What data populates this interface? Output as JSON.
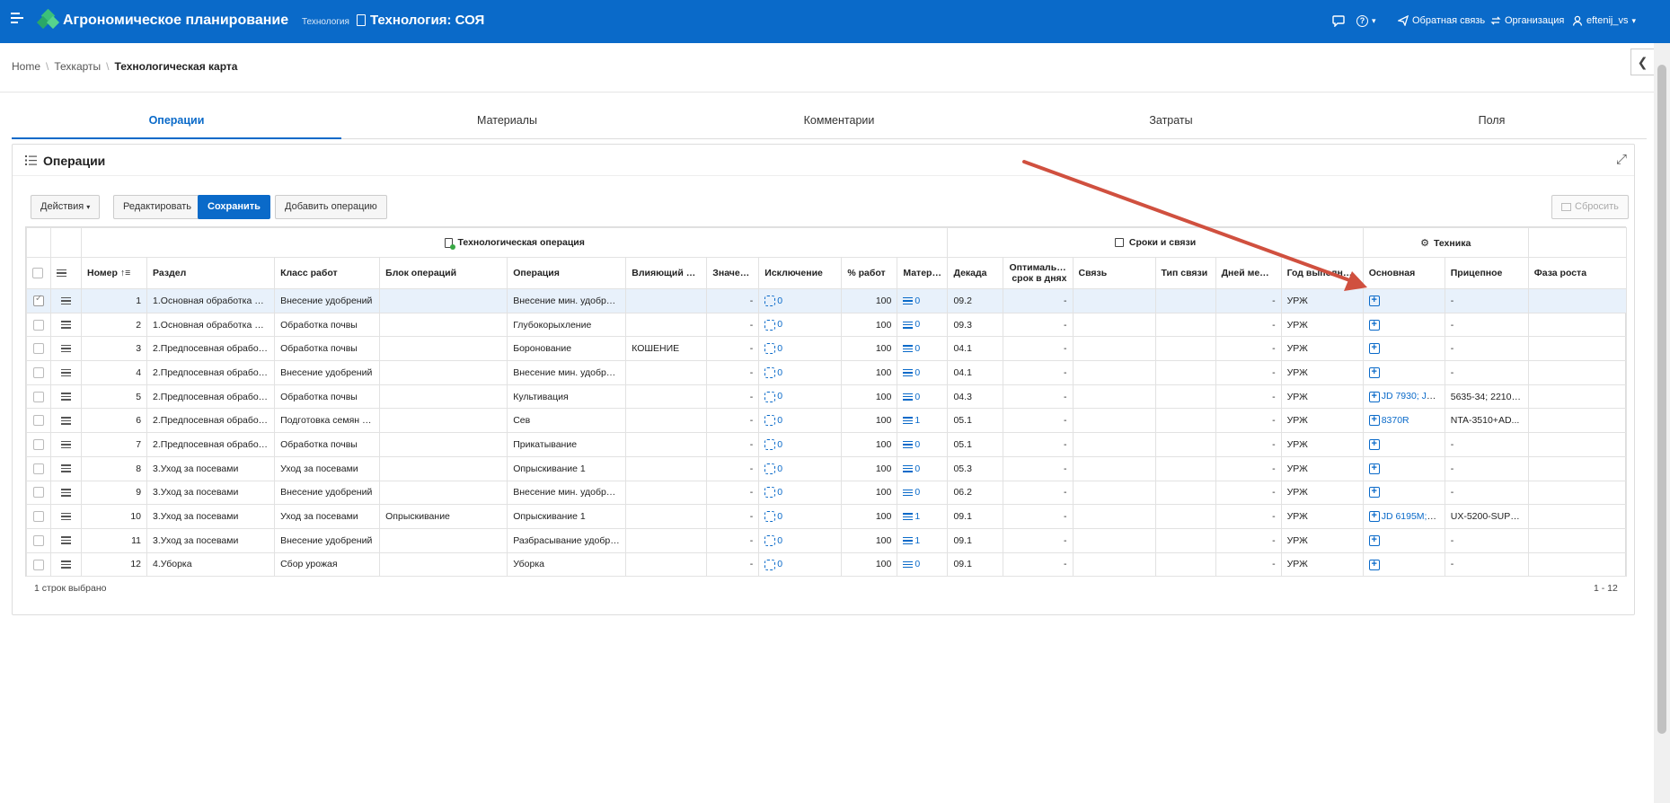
{
  "header": {
    "app_title": "Агрономическое планирование",
    "crumb_small": "Технология",
    "page_title": "Технология: СОЯ",
    "feedback": "Обратная связь",
    "organization": "Организация",
    "user": "eftenij_vs"
  },
  "breadcrumb": {
    "home": "Home",
    "parent": "Техкарты",
    "current": "Технологическая карта"
  },
  "tabs": [
    "Операции",
    "Материалы",
    "Комментарии",
    "Затраты",
    "Поля"
  ],
  "region": {
    "title": "Операции"
  },
  "toolbar": {
    "actions": "Действия",
    "edit": "Редактировать",
    "save": "Сохранить",
    "add": "Добавить операцию",
    "reset": "Сбросить"
  },
  "grid": {
    "groups": {
      "tech_op": "Технологическая операция",
      "terms": "Сроки и связи",
      "machinery": "Техника"
    },
    "columns": {
      "num": "Номер",
      "section": "Раздел",
      "work_class": "Класс работ",
      "block": "Блок операций",
      "operation": "Операция",
      "factor": "Влияющий фактор",
      "value": "Значение фактора",
      "exclusion": "Исключение",
      "pct": "% работ",
      "material": "Материал",
      "decade": "Декада",
      "optimal": "Оптимальный срок в днях",
      "link": "Связь",
      "link_type": "Тип связи",
      "days_between": "Дней между...",
      "year": "Год выполнения...",
      "main": "Основная",
      "trailer": "Прицепное",
      "phase": "Фаза роста"
    },
    "rows": [
      {
        "num": "1",
        "section": "1.Основная обработка по...",
        "work_class": "Внесение удобрений",
        "block": "",
        "operation": "Внесение мин. удобрен...",
        "factor": "",
        "value": "-",
        "exclusion": "0",
        "pct": "100",
        "material": "0",
        "decade": "09.2",
        "optimal": "-",
        "link": "",
        "link_type": "",
        "days": "-",
        "year": "УРЖ",
        "main": "",
        "trailer": "-",
        "selected": true
      },
      {
        "num": "2",
        "section": "1.Основная обработка по...",
        "work_class": "Обработка почвы",
        "block": "",
        "operation": "Глубокорыхление",
        "factor": "",
        "value": "-",
        "exclusion": "0",
        "pct": "100",
        "material": "0",
        "decade": "09.3",
        "optimal": "-",
        "link": "",
        "link_type": "",
        "days": "-",
        "year": "УРЖ",
        "main": "",
        "trailer": "-"
      },
      {
        "num": "3",
        "section": "2.Предпосевная обработ...",
        "work_class": "Обработка почвы",
        "block": "",
        "operation": "Боронование",
        "factor": "КОШЕНИЕ",
        "value": "-",
        "exclusion": "0",
        "pct": "100",
        "material": "0",
        "decade": "04.1",
        "optimal": "-",
        "link": "",
        "link_type": "",
        "days": "-",
        "year": "УРЖ",
        "main": "",
        "trailer": "-"
      },
      {
        "num": "4",
        "section": "2.Предпосевная обработ...",
        "work_class": "Внесение удобрений",
        "block": "",
        "operation": "Внесение мин. удобрен...",
        "factor": "",
        "value": "-",
        "exclusion": "0",
        "pct": "100",
        "material": "0",
        "decade": "04.1",
        "optimal": "-",
        "link": "",
        "link_type": "",
        "days": "-",
        "year": "УРЖ",
        "main": "",
        "trailer": "-"
      },
      {
        "num": "5",
        "section": "2.Предпосевная обработ...",
        "work_class": "Обработка почвы",
        "block": "",
        "operation": "Культивация",
        "factor": "",
        "value": "-",
        "exclusion": "0",
        "pct": "100",
        "material": "0",
        "decade": "04.3",
        "optimal": "-",
        "link": "",
        "link_type": "",
        "days": "-",
        "year": "УРЖ",
        "main": "JD 7930; JD ...",
        "trailer": "5635-34; 2210; ..."
      },
      {
        "num": "6",
        "section": "2.Предпосевная обработ...",
        "work_class": "Подготовка семян и...",
        "block": "",
        "operation": "Сев",
        "factor": "",
        "value": "-",
        "exclusion": "0",
        "pct": "100",
        "material": "1",
        "decade": "05.1",
        "optimal": "-",
        "link": "",
        "link_type": "",
        "days": "-",
        "year": "УРЖ",
        "main": "8370R",
        "trailer": "NTA-3510+AD..."
      },
      {
        "num": "7",
        "section": "2.Предпосевная обработ...",
        "work_class": "Обработка почвы",
        "block": "",
        "operation": "Прикатывание",
        "factor": "",
        "value": "-",
        "exclusion": "0",
        "pct": "100",
        "material": "0",
        "decade": "05.1",
        "optimal": "-",
        "link": "",
        "link_type": "",
        "days": "-",
        "year": "УРЖ",
        "main": "",
        "trailer": "-"
      },
      {
        "num": "8",
        "section": "3.Уход за посевами",
        "work_class": "Уход за посевами",
        "block": "",
        "operation": "Опрыскивание 1",
        "factor": "",
        "value": "-",
        "exclusion": "0",
        "pct": "100",
        "material": "0",
        "decade": "05.3",
        "optimal": "-",
        "link": "",
        "link_type": "",
        "days": "-",
        "year": "УРЖ",
        "main": "",
        "trailer": "-"
      },
      {
        "num": "9",
        "section": "3.Уход за посевами",
        "work_class": "Внесение удобрений",
        "block": "",
        "operation": "Внесение мин. удобрен...",
        "factor": "",
        "value": "-",
        "exclusion": "0",
        "pct": "100",
        "material": "0",
        "decade": "06.2",
        "optimal": "-",
        "link": "",
        "link_type": "",
        "days": "-",
        "year": "УРЖ",
        "main": "",
        "trailer": "-"
      },
      {
        "num": "10",
        "section": "3.Уход за посевами",
        "work_class": "Уход за посевами",
        "block": "Опрыскивание",
        "operation": "Опрыскивание 1",
        "factor": "",
        "value": "-",
        "exclusion": "0",
        "pct": "100",
        "material": "1",
        "decade": "09.1",
        "optimal": "-",
        "link": "",
        "link_type": "",
        "days": "-",
        "year": "УРЖ",
        "main": "JD 6195M; J...",
        "trailer": "UX-5200-SUPE..."
      },
      {
        "num": "11",
        "section": "3.Уход за посевами",
        "work_class": "Внесение удобрений",
        "block": "",
        "operation": "Разбрасывание удобре...",
        "factor": "",
        "value": "-",
        "exclusion": "0",
        "pct": "100",
        "material": "1",
        "decade": "09.1",
        "optimal": "-",
        "link": "",
        "link_type": "",
        "days": "-",
        "year": "УРЖ",
        "main": "",
        "trailer": "-"
      },
      {
        "num": "12",
        "section": "4.Уборка",
        "work_class": "Сбор урожая",
        "block": "",
        "operation": "Уборка",
        "factor": "",
        "value": "-",
        "exclusion": "0",
        "pct": "100",
        "material": "0",
        "decade": "09.1",
        "optimal": "-",
        "link": "",
        "link_type": "",
        "days": "-",
        "year": "УРЖ",
        "main": "",
        "trailer": "-"
      }
    ],
    "footer_selected": "1 строк выбрано",
    "footer_range": "1 - 12"
  },
  "colors": {
    "brand": "#0a6ac9",
    "annotation_arrow": "#d0503f"
  }
}
